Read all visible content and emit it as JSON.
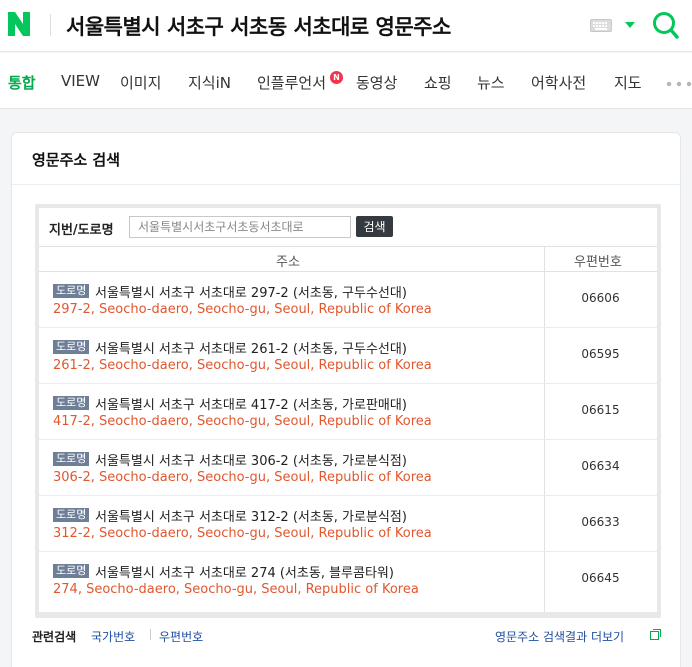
{
  "header": {
    "logo_letter": "N",
    "query": "서울특별시 서초구 서초동 서초대로 영문주소",
    "brand_color": "#03c75a"
  },
  "tabs": [
    {
      "label": "통합",
      "active": true
    },
    {
      "label": "VIEW"
    },
    {
      "label": "이미지"
    },
    {
      "label": "지식iN"
    },
    {
      "label": "인플루언서",
      "badge": "N"
    },
    {
      "label": "동영상"
    },
    {
      "label": "쇼핑"
    },
    {
      "label": "뉴스"
    },
    {
      "label": "어학사전"
    },
    {
      "label": "지도"
    }
  ],
  "card": {
    "title": "영문주소 검색",
    "search": {
      "label": "지번/도로명",
      "placeholder": "서울특별시서초구서초동서초대로",
      "button": "검색"
    },
    "columns": {
      "address": "주소",
      "zip": "우편번호"
    },
    "rows": [
      {
        "tag": "도로명",
        "kor": "서울특별시 서초구 서초대로 297-2 (서초동, 구두수선대)",
        "eng": "297-2, Seocho-daero, Seocho-gu, Seoul, Republic of Korea",
        "zip": "06606"
      },
      {
        "tag": "도로명",
        "kor": "서울특별시 서초구 서초대로 261-2 (서초동, 구두수선대)",
        "eng": "261-2, Seocho-daero, Seocho-gu, Seoul, Republic of Korea",
        "zip": "06595"
      },
      {
        "tag": "도로명",
        "kor": "서울특별시 서초구 서초대로 417-2 (서초동, 가로판매대)",
        "eng": "417-2, Seocho-daero, Seocho-gu, Seoul, Republic of Korea",
        "zip": "06615"
      },
      {
        "tag": "도로명",
        "kor": "서울특별시 서초구 서초대로 306-2 (서초동, 가로분식점)",
        "eng": "306-2, Seocho-daero, Seocho-gu, Seoul, Republic of Korea",
        "zip": "06634"
      },
      {
        "tag": "도로명",
        "kor": "서울특별시 서초구 서초대로 312-2 (서초동, 가로분식점)",
        "eng": "312-2, Seocho-daero, Seocho-gu, Seoul, Republic of Korea",
        "zip": "06633"
      },
      {
        "tag": "도로명",
        "kor": "서울특별시 서초구 서초대로 274 (서초동, 블루콤타워)",
        "eng": "274, Seocho-daero, Seocho-gu, Seoul, Republic of Korea",
        "zip": "06645"
      }
    ],
    "footer": {
      "related_label": "관련검색",
      "related_links": [
        "국가번호",
        "우편번호"
      ],
      "more": "영문주소 검색결과 더보기"
    }
  }
}
